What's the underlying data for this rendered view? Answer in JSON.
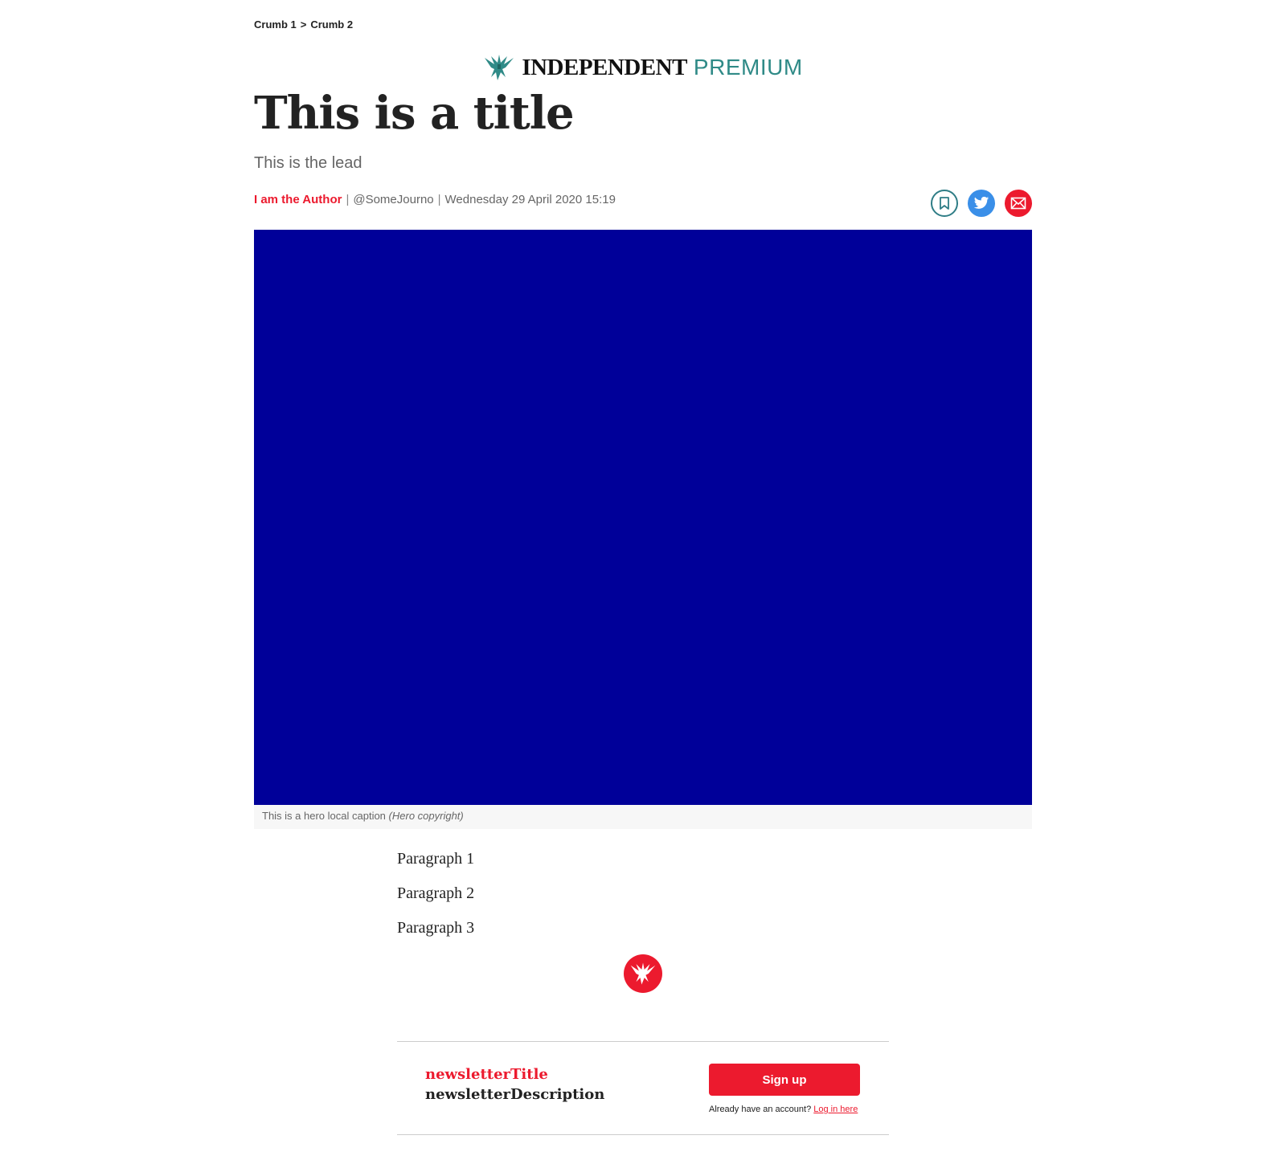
{
  "breadcrumb": {
    "items": [
      "Crumb 1",
      "Crumb 2"
    ],
    "separator": ">"
  },
  "brand": {
    "name": "INDEPENDENT",
    "tier": "PREMIUM",
    "tier_color": "#2f8a87",
    "icon": "eagle-icon"
  },
  "article": {
    "title": "This is a title",
    "lead": "This is the lead",
    "author": "I am the Author",
    "handle": "@SomeJourno",
    "date": "Wednesday 29 April 2020 15:19",
    "separator": "|",
    "accent_color": "#ec1a2e"
  },
  "share": {
    "icons": [
      "bookmark-icon",
      "twitter-icon",
      "email-icon"
    ]
  },
  "hero": {
    "color": "#000099",
    "caption": "This is a hero local caption",
    "copyright": "(Hero copyright)"
  },
  "body": {
    "paragraphs": [
      "Paragraph 1",
      "Paragraph 2",
      "Paragraph 3"
    ]
  },
  "newsletter": {
    "title": "newsletterTitle",
    "description": "newsletterDescription",
    "signup_label": "Sign up",
    "account_prompt": "Already have an account?",
    "login_label": "Log in here"
  }
}
